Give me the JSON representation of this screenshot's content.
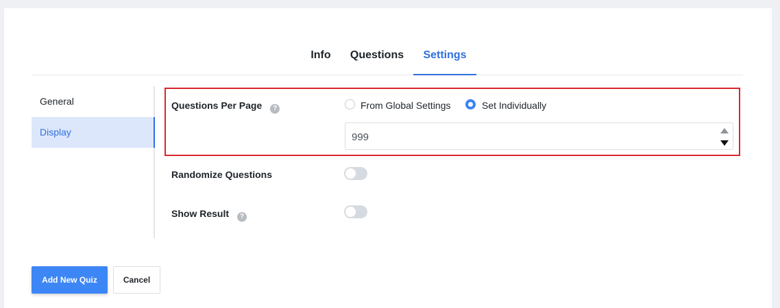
{
  "tabs": [
    {
      "label": "Info"
    },
    {
      "label": "Questions"
    },
    {
      "label": "Settings"
    }
  ],
  "sidebar": {
    "items": [
      {
        "label": "General"
      },
      {
        "label": "Display"
      }
    ],
    "active": "Display"
  },
  "questions_per_page": {
    "label": "Questions Per Page",
    "help": "?",
    "options": [
      "From Global Settings",
      "Set Individually"
    ],
    "selected": "Set Individually",
    "value": "999"
  },
  "randomize": {
    "label": "Randomize Questions",
    "enabled": false
  },
  "show_result": {
    "label": "Show Result",
    "help": "?",
    "enabled": false
  },
  "buttons": {
    "add": "Add New Quiz",
    "cancel": "Cancel"
  },
  "colors": {
    "accent": "#2f6fde",
    "primary_button": "#3d86f5",
    "highlight_border": "#d9242b"
  }
}
